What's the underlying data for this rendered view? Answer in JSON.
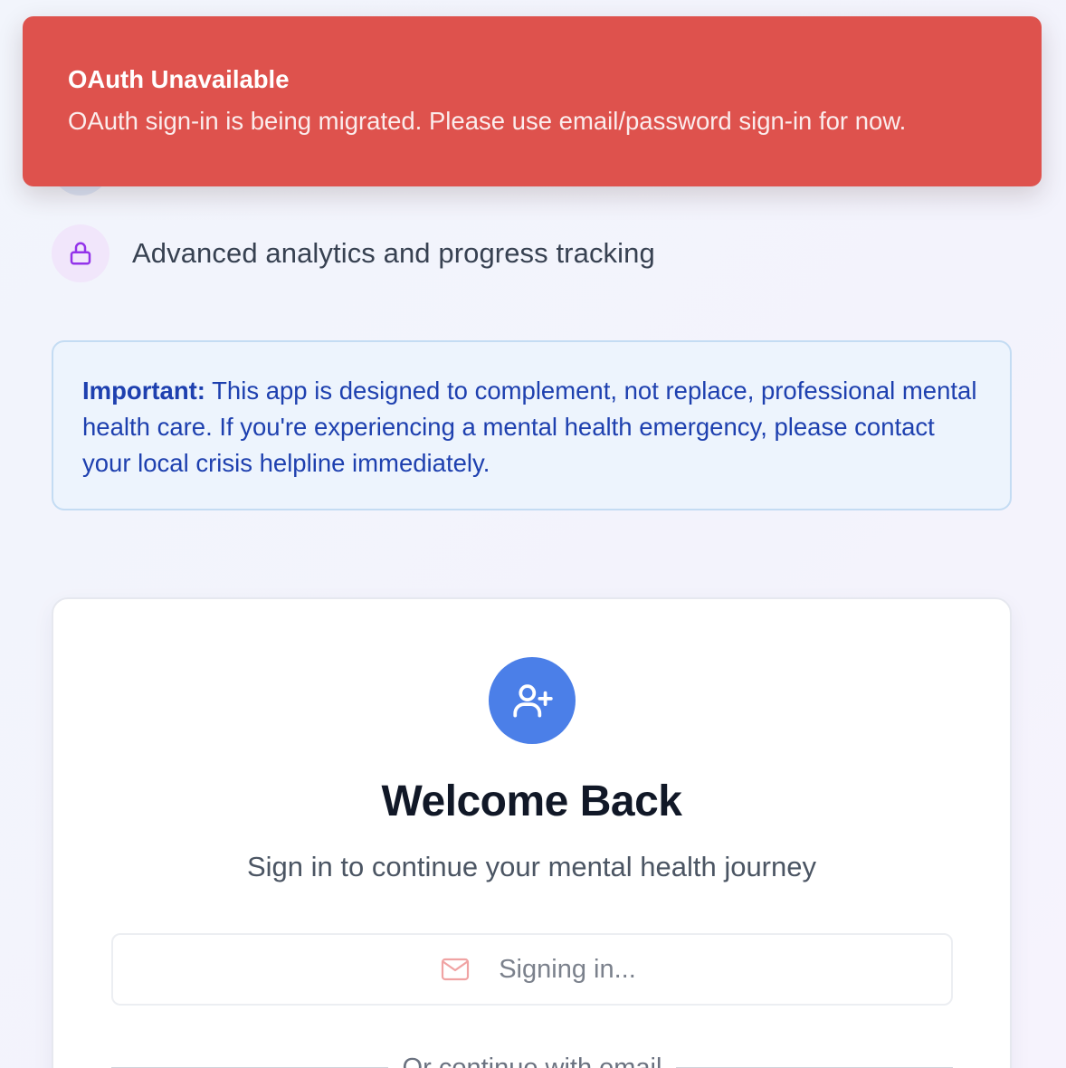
{
  "toast": {
    "title": "OAuth Unavailable",
    "message": "OAuth sign-in is being migrated. Please use email/password sign-in for now.",
    "color": "#de524d"
  },
  "features": {
    "items": [
      {
        "text": "Advanced analytics and progress tracking",
        "icon": "lock-icon",
        "color": "#9333ea"
      }
    ]
  },
  "notice": {
    "label": "Important:",
    "text": " This app is designed to complement, not replace, professional mental health care. If you're experiencing a mental health emergency, please contact your local crisis helpline immediately."
  },
  "login": {
    "avatar_icon": "user-plus-icon",
    "title": "Welcome Back",
    "subtitle": "Sign in to continue your mental health journey",
    "oauth_button_label": "Signing in...",
    "oauth_button_icon": "mail-icon",
    "divider_text": "Or continue with email"
  },
  "colors": {
    "accent": "#4b7fe8",
    "notice_text": "#1e40af",
    "notice_bg": "#edf4fd"
  }
}
